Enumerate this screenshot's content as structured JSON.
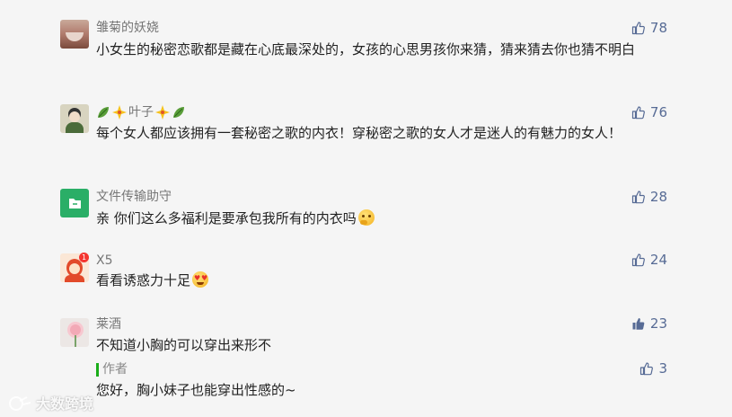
{
  "comments": [
    {
      "nickname": "雏菊的妖娆",
      "content": "小女生的秘密恋歌都是藏在心底最深处的，女孩的心思男孩你来猜，猜来猜去你也猜不明白",
      "likes": "78"
    },
    {
      "nickname": "叶子",
      "content": "每个女人都应该拥有一套秘密之歌的内衣！穿秘密之歌的女人才是迷人的有魅力的女人！",
      "likes": "76"
    },
    {
      "nickname": "文件传输助守",
      "content": "亲  你们这么多福利是要承包我所有的内衣吗",
      "likes": "28"
    },
    {
      "nickname": "X5",
      "content": "看看诱惑力十足",
      "likes": "24",
      "badge": "1"
    },
    {
      "nickname": "莱酒",
      "content": "不知道小胸的可以穿出来形不",
      "likes": "23",
      "reply": {
        "author_label": "作者",
        "content": "您好，胸小妹子也能穿出性感的~",
        "likes": "3"
      }
    }
  ],
  "watermark": "大数跨境",
  "colors": {
    "background": "#f5f5f5",
    "nickname": "#777777",
    "like": "#576b95",
    "author_bar": "#1aad19",
    "file_helper_avatar": "#2aae67"
  }
}
